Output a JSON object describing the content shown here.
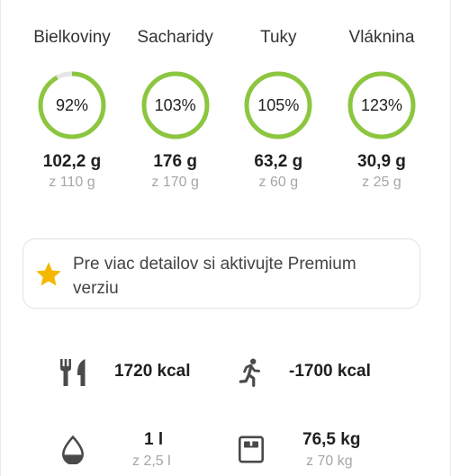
{
  "macros": [
    {
      "label": "Bielkoviny",
      "percent_label": "92%",
      "progress": 0.92,
      "value": "102,2 g",
      "target": "z 110 g"
    },
    {
      "label": "Sacharidy",
      "percent_label": "103%",
      "progress": 1.0,
      "value": "176 g",
      "target": "z 170 g"
    },
    {
      "label": "Tuky",
      "percent_label": "105%",
      "progress": 1.0,
      "value": "63,2 g",
      "target": "z 60 g"
    },
    {
      "label": "Vláknina",
      "percent_label": "123%",
      "progress": 1.0,
      "value": "30,9 g",
      "target": "z 25 g"
    }
  ],
  "premium_banner": {
    "text": "Pre viac detailov si aktivujte Premium verziu",
    "icon": "star-icon"
  },
  "stats": {
    "food": {
      "icon": "fork-knife-icon",
      "value": "1720 kcal"
    },
    "exercise": {
      "icon": "running-icon",
      "value": "-1700 kcal"
    },
    "water": {
      "icon": "water-drop-icon",
      "value": "1 l",
      "target": "z 2,5 l"
    },
    "weight": {
      "icon": "scale-icon",
      "value": "76,5 kg",
      "target": "z 70 kg"
    }
  },
  "colors": {
    "ring_progress": "#8cc63f",
    "ring_track": "#e6e6e6",
    "star": "#f5b800",
    "icon": "#4a4a4a"
  }
}
